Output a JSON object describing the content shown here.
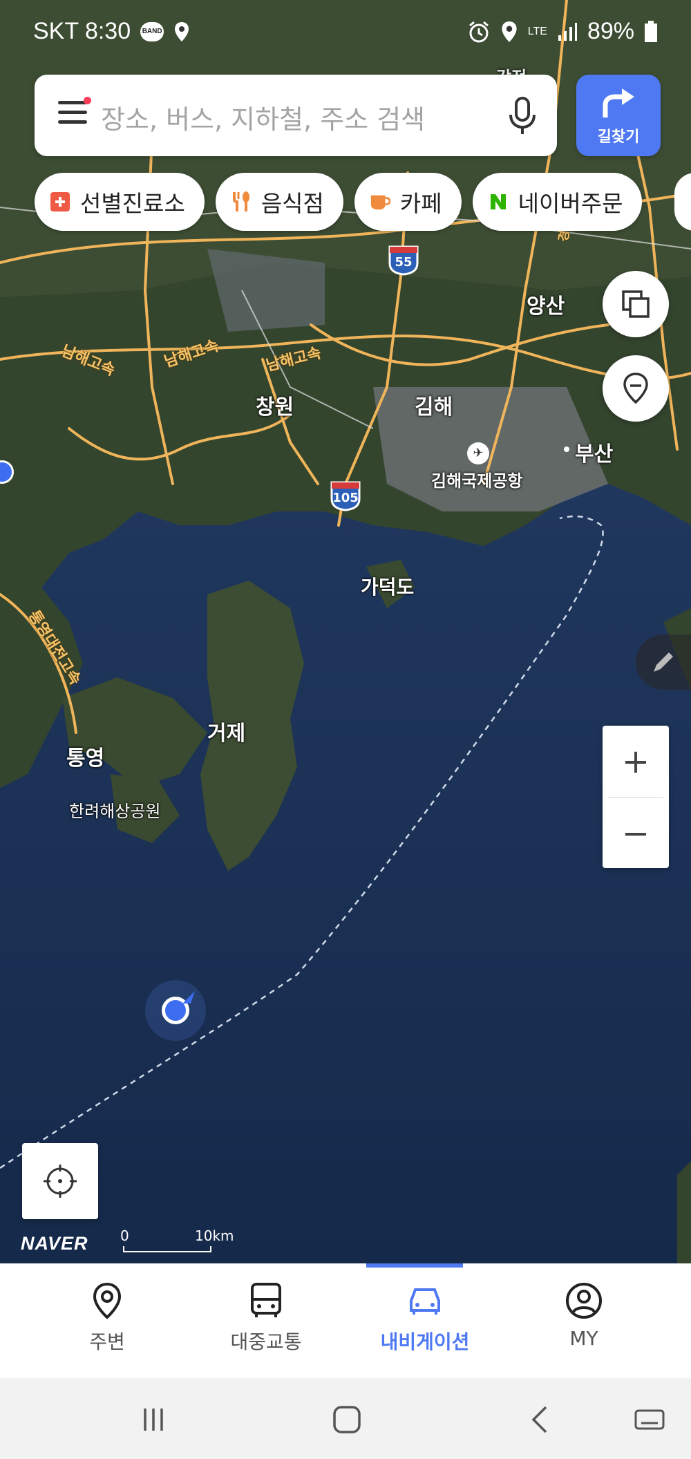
{
  "status_bar": {
    "carrier_time": "SKT 8:30",
    "band": "BAND",
    "network": "LTE",
    "battery": "89%"
  },
  "search": {
    "placeholder": "장소, 버스, 지하철, 주소 검색",
    "route_label": "길찾기"
  },
  "chips": [
    {
      "label": "선별진료소",
      "icon": "plus-cross-icon"
    },
    {
      "label": "음식점",
      "icon": "utensils-icon"
    },
    {
      "label": "카페",
      "icon": "cup-icon"
    },
    {
      "label": "네이버주문",
      "icon": "naver-n-icon"
    }
  ],
  "map": {
    "places": {
      "changwon": "창원",
      "gimhae": "김해",
      "busan": "부산",
      "yangsan": "양산",
      "airport": "김해국제공항",
      "gadeokdo": "가덕도",
      "geoje": "거제",
      "tongyeong": "통영",
      "hallyeo": "한려해상공원",
      "partial_top": "감전"
    },
    "roads": {
      "namhae1": "남해고속",
      "namhae2": "남해고속",
      "namhae3": "남해고속",
      "tongyeong_daejeon": "통영대전고속",
      "right_edge": "경부"
    },
    "shields": {
      "s55": "55",
      "s105": "105"
    },
    "brand": "NAVER",
    "scale_zero": "0",
    "scale_km": "10km",
    "zoom_in": "+",
    "zoom_out": "−"
  },
  "tabs": [
    {
      "label": "주변",
      "icon": "location-pin-icon"
    },
    {
      "label": "대중교통",
      "icon": "bus-icon"
    },
    {
      "label": "내비게이션",
      "icon": "car-icon",
      "active": true
    },
    {
      "label": "MY",
      "icon": "profile-icon"
    }
  ],
  "colors": {
    "accent": "#4f79f3",
    "road": "#f0b55a",
    "sea": "#1c2f4f"
  }
}
